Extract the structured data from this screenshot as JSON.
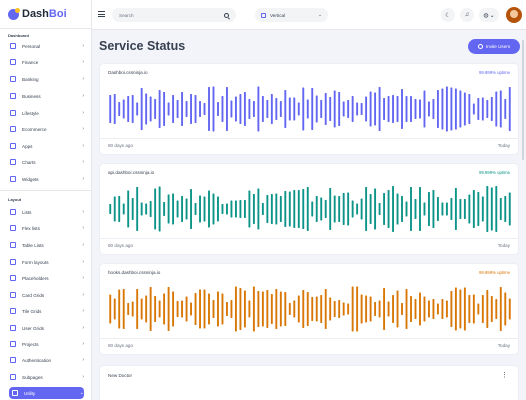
{
  "brand": {
    "name_part1": "Dash",
    "name_part2": "Boi"
  },
  "sidebar": {
    "sections": [
      {
        "label": "Dashboard",
        "items": [
          {
            "label": "Personal",
            "icon": "home-icon"
          },
          {
            "label": "Finance",
            "icon": "chart-icon"
          },
          {
            "label": "Banking",
            "icon": "bank-icon"
          },
          {
            "label": "Business",
            "icon": "briefcase-icon"
          },
          {
            "label": "Lifestyle",
            "icon": "heart-icon"
          },
          {
            "label": "Ecommerce",
            "icon": "cart-icon"
          },
          {
            "label": "Apps",
            "icon": "apps-icon"
          },
          {
            "label": "Charts",
            "icon": "pie-icon"
          },
          {
            "label": "Widgets",
            "icon": "widget-icon"
          }
        ]
      },
      {
        "label": "Layout",
        "items": [
          {
            "label": "Lists",
            "icon": "list-icon"
          },
          {
            "label": "Flex lists",
            "icon": "list-icon"
          },
          {
            "label": "Table Lists",
            "icon": "table-icon"
          },
          {
            "label": "Form layouts",
            "icon": "form-icon"
          },
          {
            "label": "Placeholders",
            "icon": "placeholder-icon"
          },
          {
            "label": "Card Grids",
            "icon": "grid-icon"
          },
          {
            "label": "Tile Grids",
            "icon": "grid-icon"
          },
          {
            "label": "User Grids",
            "icon": "users-icon"
          },
          {
            "label": "Projects",
            "icon": "folder-icon"
          },
          {
            "label": "Authentication",
            "icon": "lock-icon"
          },
          {
            "label": "Subpages",
            "icon": "page-icon"
          },
          {
            "label": "Utility",
            "icon": "gear-icon"
          }
        ]
      }
    ]
  },
  "topbar": {
    "search_placeholder": "Search",
    "layout_value": "Vertical"
  },
  "page": {
    "title": "Service Status",
    "invite_label": "Invite Users"
  },
  "services": [
    {
      "host": "Dashboi.cssninja.io",
      "uptime": "99.999% uptime",
      "color": "#6366f1",
      "left_label": "90 days ago",
      "right_label": "Today"
    },
    {
      "host": "api.dashboi.cssninja.io",
      "uptime": "99.999% uptime",
      "color": "#0d9488",
      "left_label": "90 days ago",
      "right_label": "Today"
    },
    {
      "host": "hooks.dashboi.cssninja.io",
      "uptime": "99.999% uptime",
      "color": "#d97706",
      "left_label": "90 days ago",
      "right_label": "Today"
    }
  ],
  "doctor_card": {
    "title": "New Doctor"
  },
  "colors": {
    "accent": "#6366f1",
    "teal": "#0d9488",
    "amber": "#d97706"
  }
}
